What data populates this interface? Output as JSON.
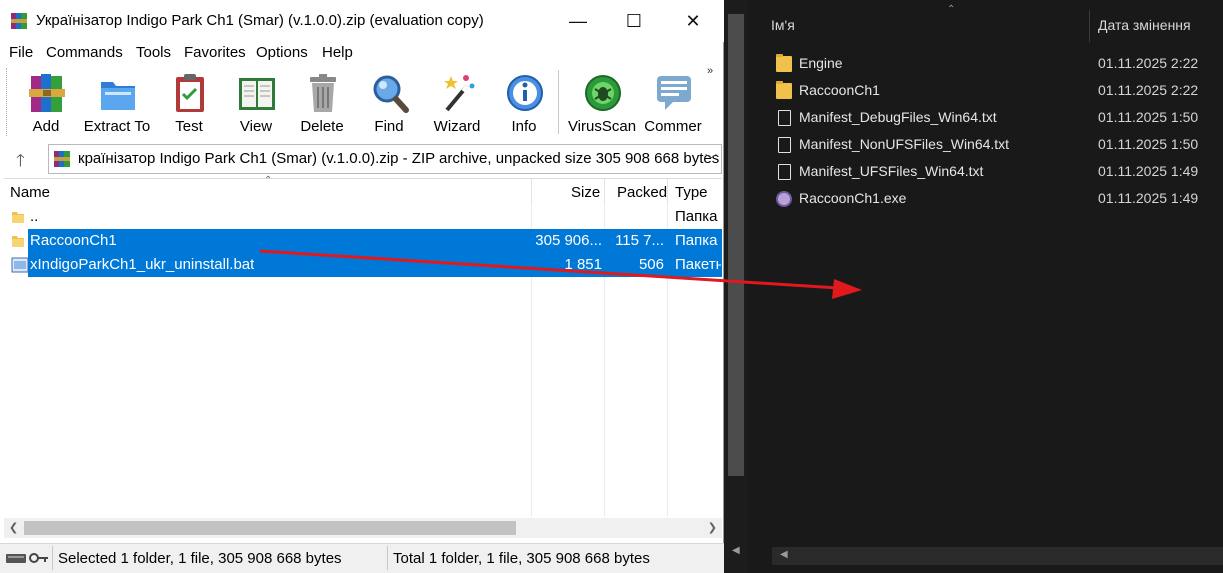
{
  "winrar": {
    "title": "Українізатор Indigo Park Ch1 (Smar) (v.1.0.0).zip (evaluation copy)",
    "menu": [
      "File",
      "Commands",
      "Tools",
      "Favorites",
      "Options",
      "Help"
    ],
    "toolbar": [
      {
        "label": "Add",
        "icon": "archive-books-icon"
      },
      {
        "label": "Extract To",
        "icon": "folder-extract-icon"
      },
      {
        "label": "Test",
        "icon": "clipboard-check-icon"
      },
      {
        "label": "View",
        "icon": "open-book-icon"
      },
      {
        "label": "Delete",
        "icon": "trash-can-icon"
      },
      {
        "label": "Find",
        "icon": "magnifier-icon"
      },
      {
        "label": "Wizard",
        "icon": "magic-wand-icon"
      },
      {
        "label": "Info",
        "icon": "info-icon"
      },
      {
        "label": "VirusScan",
        "icon": "bug-scan-icon"
      },
      {
        "label": "Commer",
        "icon": "comment-icon"
      }
    ],
    "address": "країнізатор Indigo Park Ch1 (Smar) (v.1.0.0).zip - ZIP archive, unpacked size 305 908 668 bytes",
    "columns": {
      "name": "Name",
      "size": "Size",
      "packed": "Packed",
      "type": "Type"
    },
    "files": [
      {
        "name": "..",
        "size": "",
        "packed": "",
        "type": "Папка",
        "icon": "folder-icon",
        "selected": false
      },
      {
        "name": "RaccoonCh1",
        "size": "305 906...",
        "packed": "115 7...",
        "type": "Папка",
        "icon": "folder-icon",
        "selected": true
      },
      {
        "name": "xIndigoParkCh1_ukr_uninstall.bat",
        "size": "1 851",
        "packed": "506",
        "type": "Пакетн",
        "icon": "batch-file-icon",
        "selected": true
      }
    ],
    "status": {
      "selected": "Selected 1 folder, 1 file, 305 908 668 bytes",
      "total": "Total 1 folder, 1 file, 305 908 668 bytes"
    }
  },
  "explorer": {
    "columns": {
      "name": "Ім'я",
      "date": "Дата змінення"
    },
    "files": [
      {
        "name": "Engine",
        "date": "01.11.2025 2:22",
        "icon": "folder-icon"
      },
      {
        "name": "RaccoonCh1",
        "date": "01.11.2025 2:22",
        "icon": "folder-icon"
      },
      {
        "name": "Manifest_DebugFiles_Win64.txt",
        "date": "01.11.2025 1:50",
        "icon": "text-file-icon"
      },
      {
        "name": "Manifest_NonUFSFiles_Win64.txt",
        "date": "01.11.2025 1:50",
        "icon": "text-file-icon"
      },
      {
        "name": "Manifest_UFSFiles_Win64.txt",
        "date": "01.11.2025 1:49",
        "icon": "text-file-icon"
      },
      {
        "name": "RaccoonCh1.exe",
        "date": "01.11.2025 1:49",
        "icon": "exe-app-icon"
      }
    ]
  },
  "colors": {
    "selection": "#0078d7",
    "arrow": "#e0191c"
  }
}
